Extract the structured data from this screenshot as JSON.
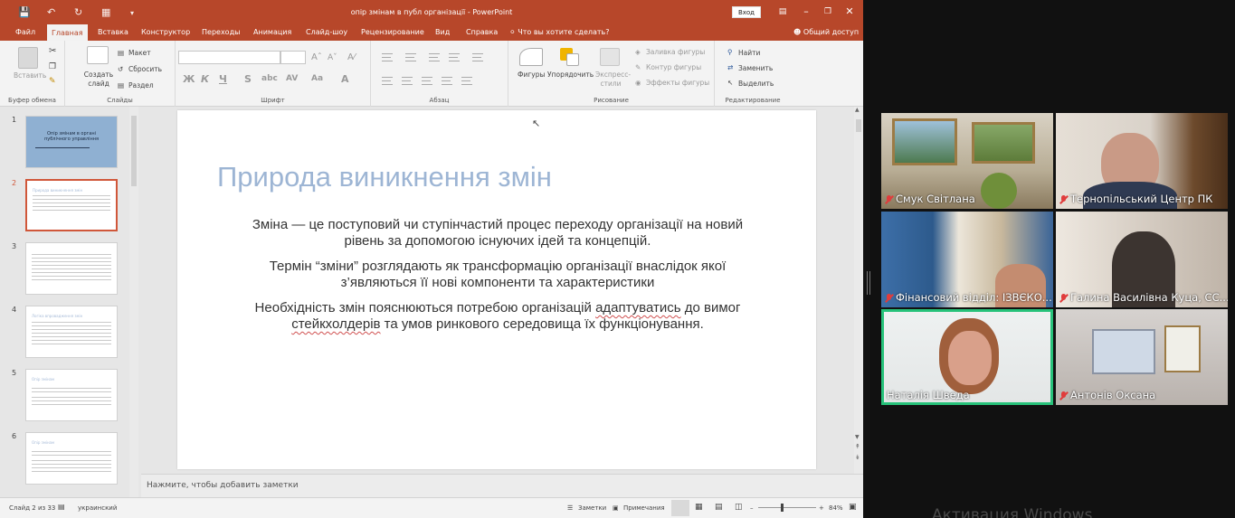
{
  "titlebar": {
    "title": "опір змінам в публ організації  -  PowerPoint",
    "login": "Вход",
    "accent": "#b7472a"
  },
  "tabs": [
    "Файл",
    "Главная",
    "Вставка",
    "Конструктор",
    "Переходы",
    "Анимация",
    "Слайд-шоу",
    "Рецензирование",
    "Вид",
    "Справка"
  ],
  "tell_me": "Что вы хотите сделать?",
  "share": "Общий доступ",
  "ribbon": {
    "clipboard": {
      "paste": "Вставить",
      "label": "Буфер обмена"
    },
    "slides": {
      "new_slide": "Создать слайд",
      "layout": "Макет",
      "reset": "Сбросить",
      "section": "Раздел",
      "label": "Слайды"
    },
    "font": {
      "label": "Шрифт",
      "bold": "Ж",
      "italic": "К",
      "underline": "Ч",
      "strike": "S"
    },
    "paragraph": {
      "label": "Абзац"
    },
    "drawing": {
      "shapes": "Фигуры",
      "arrange": "Упорядочить",
      "quick_styles": "Экспресс-стили",
      "fill": "Заливка фигуры",
      "outline": "Контур фигуры",
      "effects": "Эффекты фигуры",
      "label": "Рисование"
    },
    "editing": {
      "find": "Найти",
      "replace": "Заменить",
      "select": "Выделить",
      "label": "Редактирование"
    }
  },
  "thumbnails": [
    {
      "num": "1",
      "title": "Опір змінам в органі публічного управління"
    },
    {
      "num": "2",
      "title": "Природа виникнення змін"
    },
    {
      "num": "3",
      "title": ""
    },
    {
      "num": "4",
      "title": "Логіка впровадження змін"
    },
    {
      "num": "5",
      "title": "Опір змінам"
    },
    {
      "num": "6",
      "title": "Опір змінам"
    }
  ],
  "slide": {
    "title": "Природа виникнення змін",
    "p1_line1": "Зміна — це поступовий чи ступінчастий процес переходу організації на новий",
    "p1_line2": "рівень за допомогою існуючих ідей та концепцій.",
    "p2_line1": "Термін “зміни” розглядають як трансформацію організації внаслідок якої",
    "p2_line2": "з’являються її нові компоненти та характеристики",
    "p3_line1_a": "Необхідність змін пояснюються потребою організацій ",
    "p3_line1_b": "адаптуватись",
    "p3_line1_c": " до вимог",
    "p3_line2_a": "стейкхолдерів",
    "p3_line2_b": " та умов ринкового середовища їх функціонування."
  },
  "notes_placeholder": "Нажмите, чтобы добавить заметки",
  "statusbar": {
    "slide_of": "Слайд 2 из 33",
    "language": "украинский",
    "notes": "Заметки",
    "comments": "Примечания",
    "zoom": "84%"
  },
  "participants": [
    {
      "name": "Смук Світлана",
      "muted": true
    },
    {
      "name": "Тернопільський Центр ПК",
      "muted": true
    },
    {
      "name": "Фінансовий відділ: ІЗВЄКО...",
      "muted": true
    },
    {
      "name": "Галина Василівна Куца, СС...",
      "muted": true
    },
    {
      "name": "Наталія Шведа",
      "muted": false,
      "active": true
    },
    {
      "name": "Антонів Оксана",
      "muted": true
    }
  ],
  "watermark": "Активация Windows"
}
